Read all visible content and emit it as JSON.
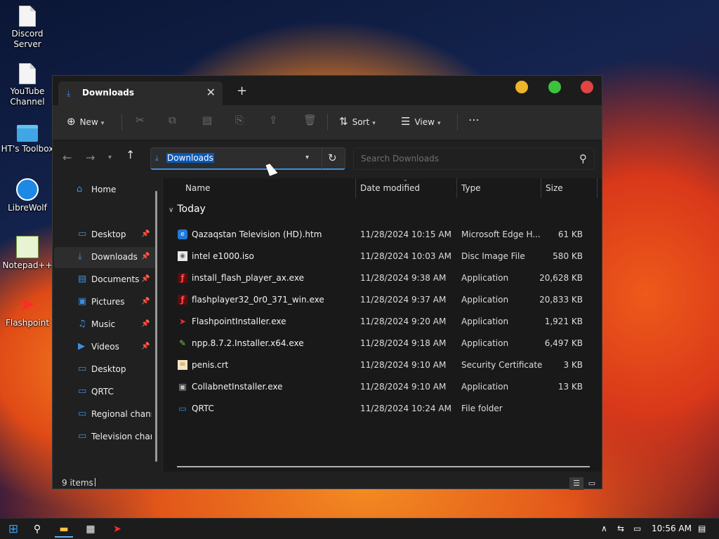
{
  "desktop": {
    "icons": [
      {
        "label": "Discord Server",
        "icon": "document-icon"
      },
      {
        "label": "YouTube Channel",
        "icon": "document-icon"
      },
      {
        "label": "HT's Toolbox",
        "icon": "folder-icon"
      },
      {
        "label": "LibreWolf",
        "icon": "librewolf-icon"
      },
      {
        "label": "Notepad++",
        "icon": "notepadpp-icon"
      },
      {
        "label": "Flashpoint",
        "icon": "flashpoint-icon"
      }
    ]
  },
  "window": {
    "tab_title": "Downloads",
    "tab_close_glyph": "✕",
    "new_tab_glyph": "+",
    "toolbar": {
      "new_label": "New",
      "sort_label": "Sort",
      "view_label": "View",
      "more_glyph": "⋯"
    },
    "address": {
      "path": "Downloads",
      "search_placeholder": "Search Downloads"
    },
    "sidebar": {
      "items": [
        {
          "label": "Home",
          "icon": "home-icon",
          "pinned": false
        },
        {
          "label": "Desktop",
          "icon": "desktop-icon",
          "pinned": true
        },
        {
          "label": "Downloads",
          "icon": "download-icon",
          "pinned": true,
          "selected": true
        },
        {
          "label": "Documents",
          "icon": "documents-icon",
          "pinned": true
        },
        {
          "label": "Pictures",
          "icon": "pictures-icon",
          "pinned": true
        },
        {
          "label": "Music",
          "icon": "music-icon",
          "pinned": true
        },
        {
          "label": "Videos",
          "icon": "videos-icon",
          "pinned": true
        },
        {
          "label": "Desktop",
          "icon": "folder-icon",
          "pinned": false
        },
        {
          "label": "QRTC",
          "icon": "folder-icon",
          "pinned": false
        },
        {
          "label": "Regional channe",
          "icon": "folder-icon",
          "pinned": false
        },
        {
          "label": "Television chann",
          "icon": "folder-icon",
          "pinned": false
        }
      ]
    },
    "columns": {
      "name": "Name",
      "date_modified": "Date modified",
      "type": "Type",
      "size": "Size"
    },
    "group_label": "Today",
    "files": [
      {
        "name": "Qazaqstan Television (HD).htm",
        "date": "11/28/2024 10:15 AM",
        "type": "Microsoft Edge H...",
        "size": "61 KB",
        "icon": "edge-html-icon"
      },
      {
        "name": "intel e1000.iso",
        "date": "11/28/2024 10:03 AM",
        "type": "Disc Image File",
        "size": "580 KB",
        "icon": "disc-image-icon"
      },
      {
        "name": "install_flash_player_ax.exe",
        "date": "11/28/2024 9:38 AM",
        "type": "Application",
        "size": "20,628 KB",
        "icon": "flash-player-icon"
      },
      {
        "name": "flashplayer32_0r0_371_win.exe",
        "date": "11/28/2024 9:37 AM",
        "type": "Application",
        "size": "20,833 KB",
        "icon": "flash-player-icon"
      },
      {
        "name": "FlashpointInstaller.exe",
        "date": "11/28/2024 9:20 AM",
        "type": "Application",
        "size": "1,921 KB",
        "icon": "flashpoint-icon"
      },
      {
        "name": "npp.8.7.2.Installer.x64.exe",
        "date": "11/28/2024 9:18 AM",
        "type": "Application",
        "size": "6,497 KB",
        "icon": "notepadpp-icon"
      },
      {
        "name": "penis.crt",
        "date": "11/28/2024 9:10 AM",
        "type": "Security Certificate",
        "size": "3 KB",
        "icon": "certificate-icon"
      },
      {
        "name": "CollabnetInstaller.exe",
        "date": "11/28/2024 9:10 AM",
        "type": "Application",
        "size": "13 KB",
        "icon": "installer-icon"
      },
      {
        "name": "QRTC",
        "date": "11/28/2024 10:24 AM",
        "type": "File folder",
        "size": "",
        "icon": "folder-icon"
      }
    ],
    "status": {
      "item_count": "9 items"
    }
  },
  "taskbar": {
    "clock": "10:56 AM"
  }
}
